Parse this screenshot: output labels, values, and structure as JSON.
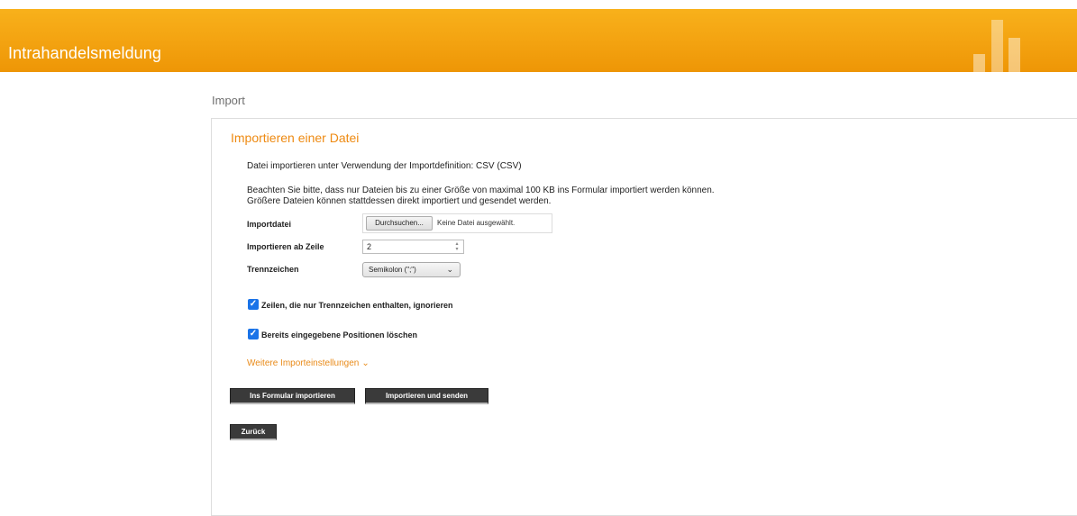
{
  "header": {
    "title": "Intrahandelsmeldung",
    "background_color": "#f3a210",
    "logo": "bar-chart-logo-icon"
  },
  "page": {
    "heading": "Import"
  },
  "panel": {
    "title": "Importieren einer Datei",
    "accent_color": "#ee8a12",
    "definition_text": "Datei importieren unter Verwendung der Importdefinition: CSV (CSV)",
    "notice_line1": "Beachten Sie bitte, dass nur Dateien bis zu einer Größe von maximal 100 KB ins Formular importiert werden können.",
    "notice_line2": "Größere Dateien können stattdessen direkt importiert und gesendet werden."
  },
  "form": {
    "importfile_label": "Importdatei",
    "browse_button": "Durchsuchen...",
    "file_status": "Keine Datei ausgewählt.",
    "start_row_label": "Importieren ab Zeile",
    "start_row_value": "2",
    "separator_label": "Trennzeichen",
    "separator_value": "Semikolon (\";\")",
    "ignore_separator_rows_label": "Zeilen, die nur Trennzeichen enthalten, ignorieren",
    "ignore_separator_rows_checked": true,
    "delete_positions_label": "Bereits eingegebene Positionen löschen",
    "delete_positions_checked": true,
    "more_settings_link": "Weitere Importeinstellungen"
  },
  "actions": {
    "import_to_form": "Ins Formular importieren",
    "import_and_send": "Importieren und senden",
    "back": "Zurück"
  }
}
